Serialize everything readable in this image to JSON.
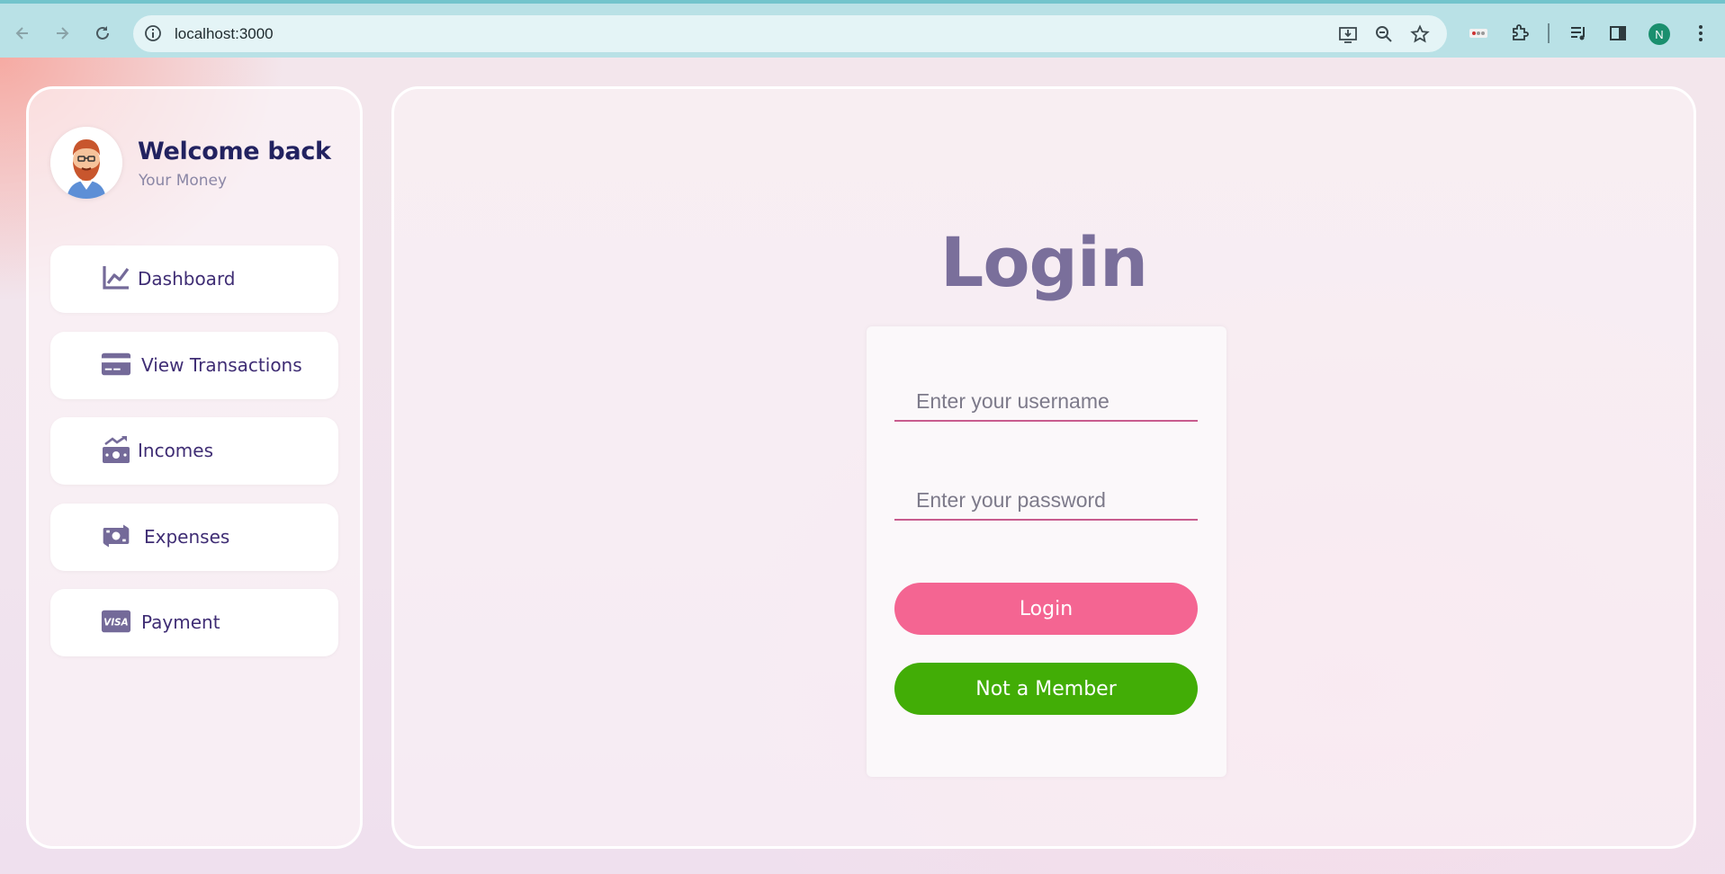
{
  "browser": {
    "url": "localhost:3000",
    "profile_initial": "N",
    "icons": [
      "back-icon",
      "forward-icon",
      "reload-icon",
      "site-info-icon",
      "install-icon",
      "zoom-icon",
      "bookmark-star-icon",
      "extension-badge-icon",
      "puzzle-extensions-icon",
      "media-queue-icon",
      "side-panel-icon",
      "more-menu-icon"
    ]
  },
  "sidebar": {
    "welcome": "Welcome back",
    "subtitle": "Your Money",
    "items": [
      {
        "label": "Dashboard",
        "icon": "chart-line-icon"
      },
      {
        "label": "View Transactions",
        "icon": "credit-card-icon"
      },
      {
        "label": "Incomes",
        "icon": "money-bill-trend-icon"
      },
      {
        "label": "Expenses",
        "icon": "money-bill-transfer-icon"
      },
      {
        "label": "Payment",
        "icon": "visa-card-icon"
      }
    ]
  },
  "login": {
    "title": "Login",
    "username_placeholder": "Enter your username",
    "password_placeholder": "Enter your password",
    "login_button": "Login",
    "member_button": "Not a Member"
  },
  "colors": {
    "accent_pink": "#f46592",
    "success_green": "#42ad06",
    "title_purple": "#7a6f9b",
    "nav_text": "#3f2d74"
  }
}
